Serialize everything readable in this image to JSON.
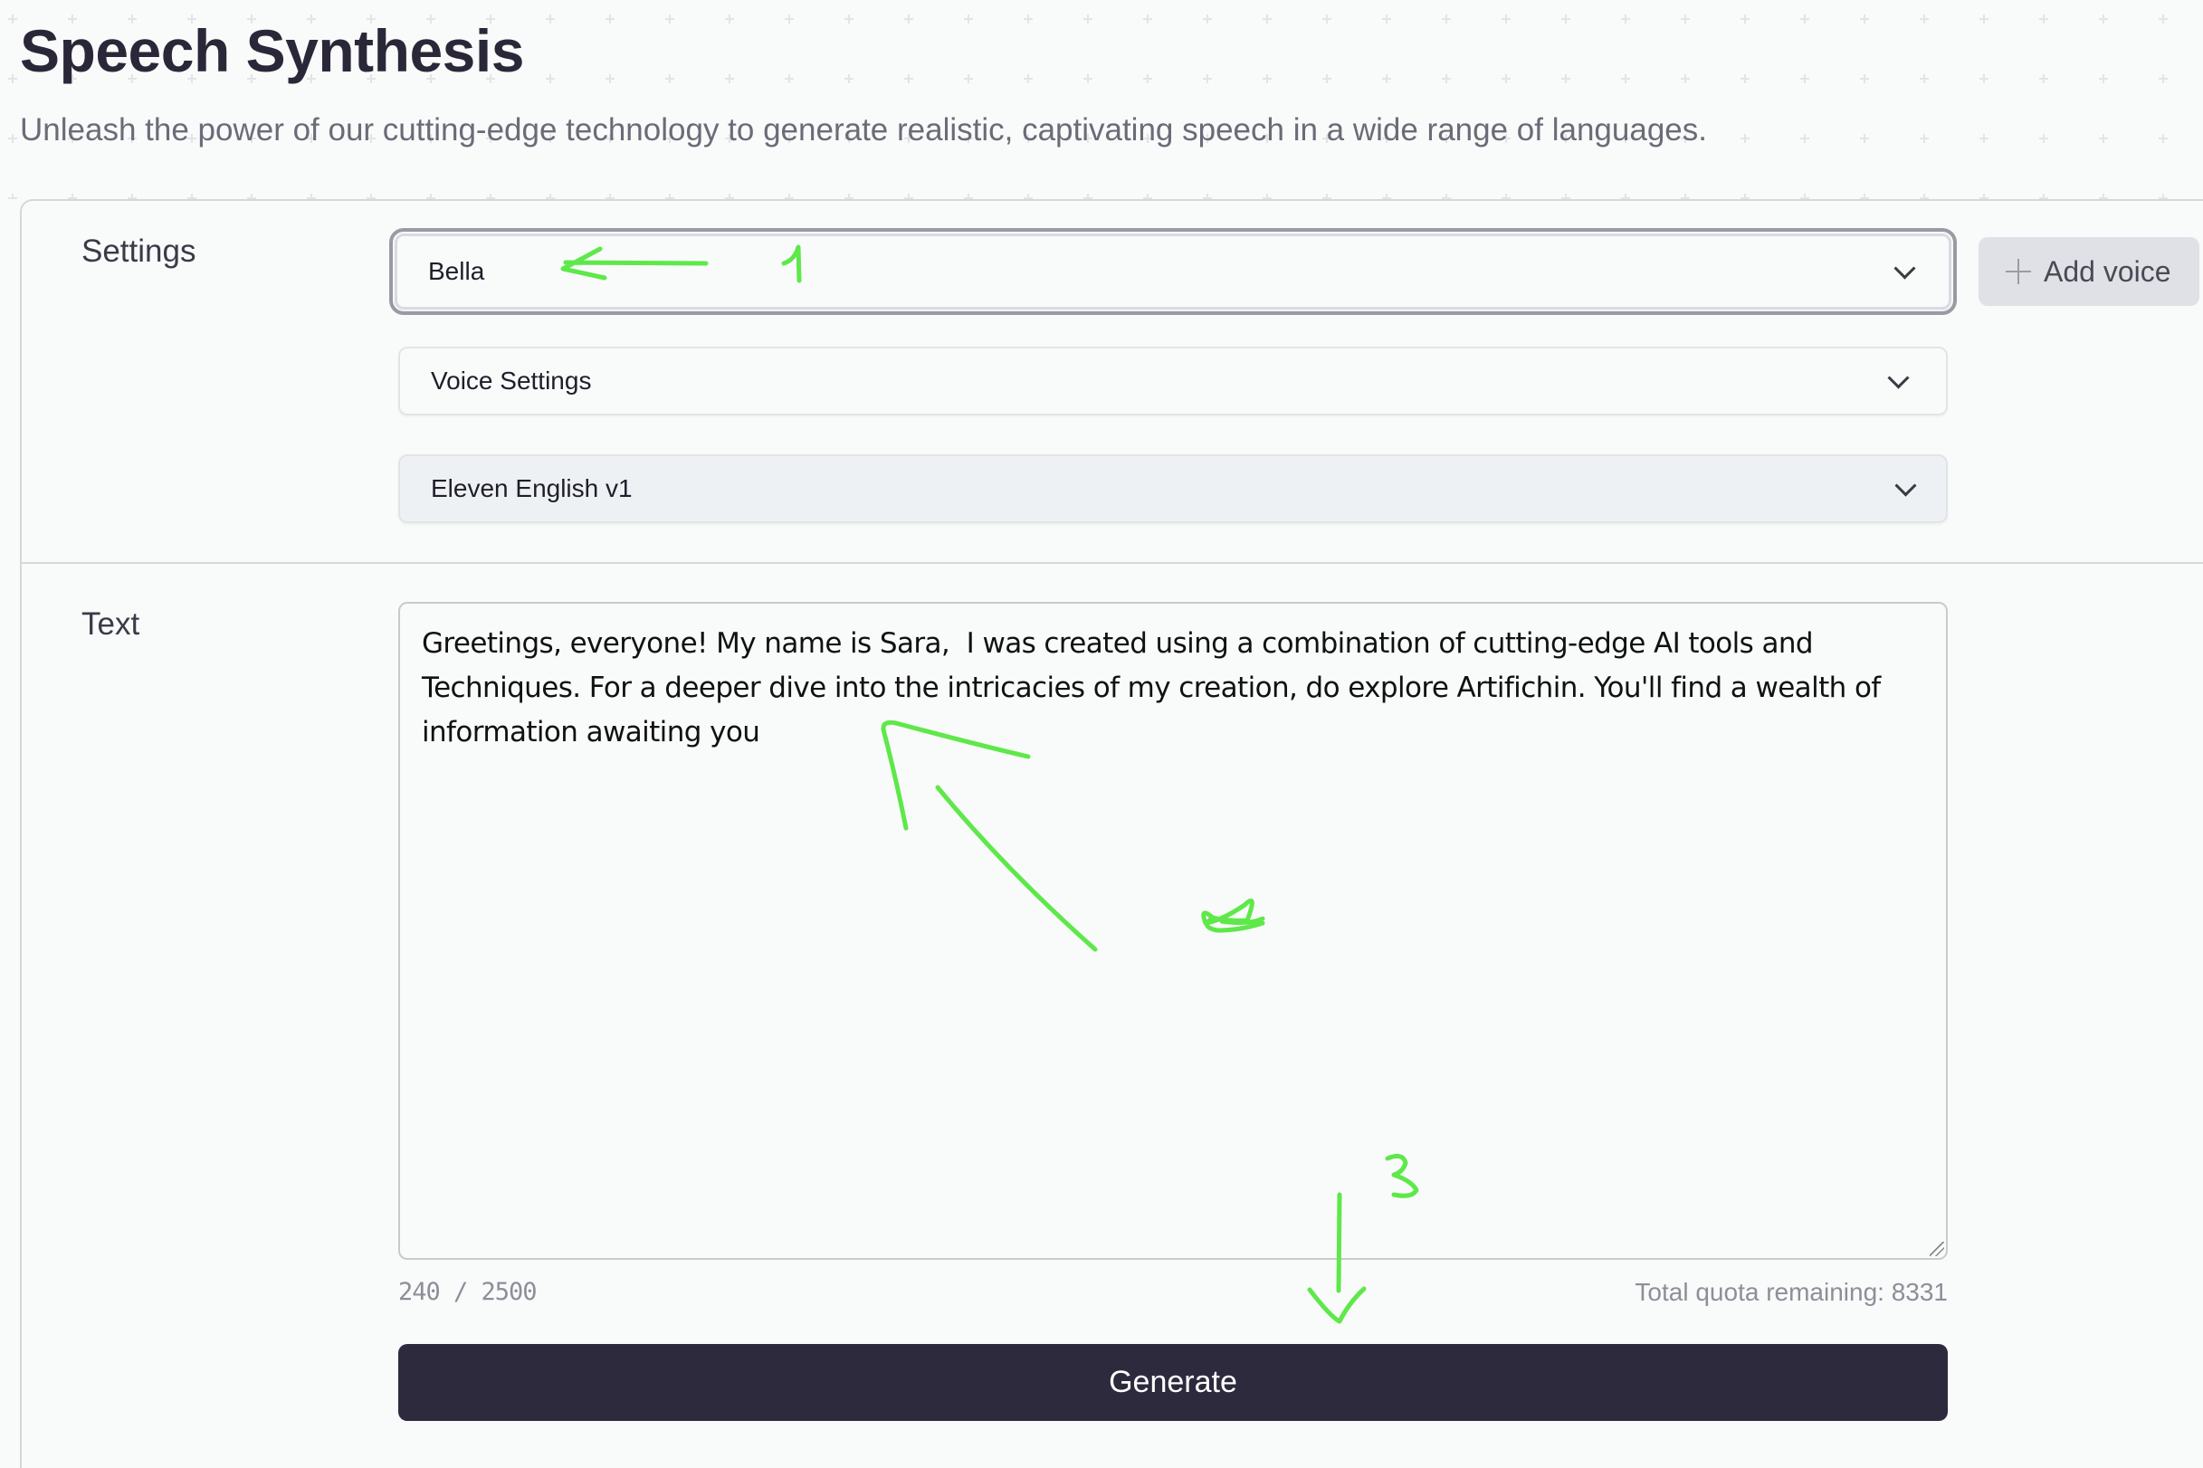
{
  "header": {
    "title": "Speech Synthesis",
    "subtitle": "Unleash the power of our cutting-edge technology to generate realistic, captivating speech in a wide range of languages."
  },
  "settings": {
    "label": "Settings",
    "voice_select": {
      "value": "Bella"
    },
    "add_voice_label": "Add voice",
    "voice_settings_select": {
      "value": "Voice Settings"
    },
    "model_select": {
      "value": "Eleven English v1"
    }
  },
  "text_section": {
    "label": "Text",
    "textarea_value": "Greetings, everyone! My name is Sara,  I was created using a combination of cutting-edge AI tools and Techniques. For a deeper dive into the intricacies of my creation, do explore Artifichin. You'll find a wealth of information awaiting you",
    "char_count": "240 / 2500",
    "quota": "Total quota remaining: 8331"
  },
  "actions": {
    "generate_label": "Generate"
  },
  "annotations": {
    "color": "#5ee84a",
    "labels": [
      "1",
      "2",
      "3"
    ]
  }
}
